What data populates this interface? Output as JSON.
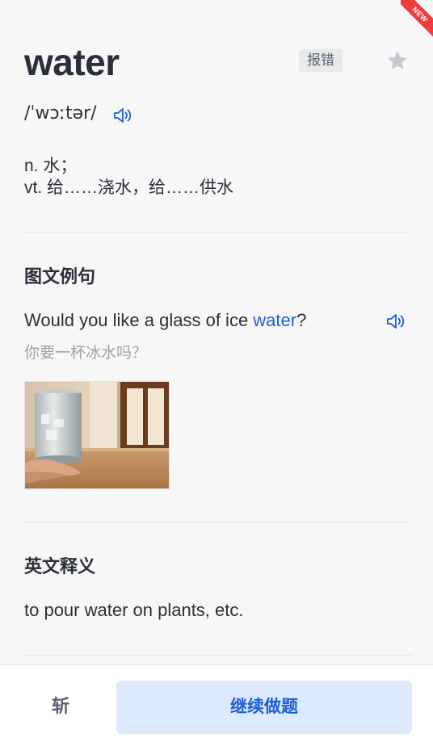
{
  "badge": {
    "new_label": "NEW"
  },
  "word": {
    "text": "water",
    "report_label": "报错",
    "phonetic": "/ˈwɔːtər/",
    "definitions": [
      "n. 水；",
      "vt. 给……浇水，给……供水"
    ]
  },
  "example_section": {
    "title": "图文例句",
    "sentence_before": "Would you like a glass of ice ",
    "sentence_highlight": "water",
    "sentence_after": "?",
    "translation": "你要一杯冰水吗？",
    "image_label": "glass-of-ice-water-photo"
  },
  "english_def_section": {
    "title": "英文释义",
    "definition": "to pour water on plants, etc."
  },
  "bottom": {
    "cut_label": "斩",
    "continue_label": "继续做题"
  },
  "colors": {
    "accent": "#1f5fd6",
    "accent_bg": "#dde9fc",
    "badge_red": "#ef3d3d",
    "text": "#2b2f3b",
    "muted": "#9ca0ab"
  },
  "icons": {
    "star": "star-icon",
    "speaker": "speaker-icon"
  }
}
